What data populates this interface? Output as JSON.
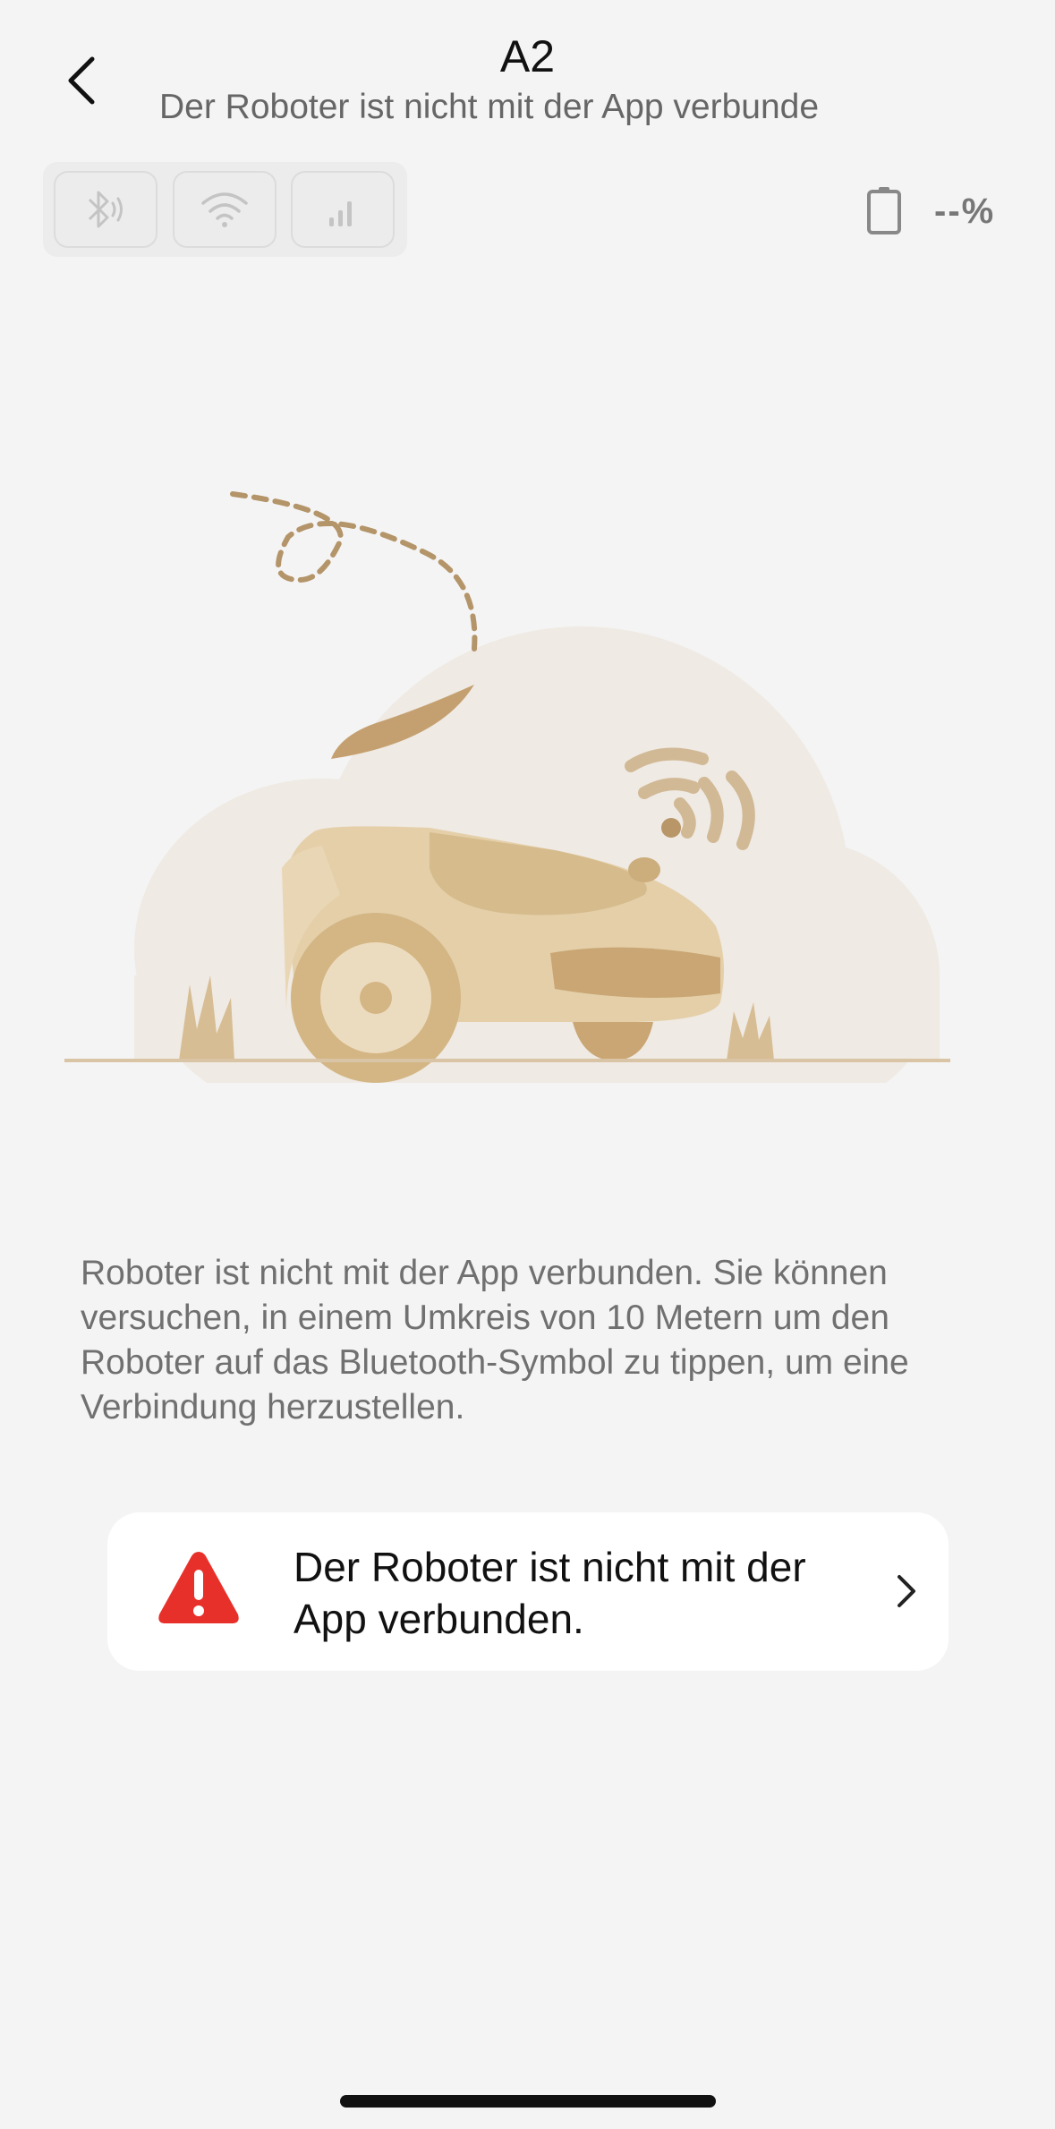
{
  "header": {
    "title": "A2",
    "subtitle": "Der Roboter ist nicht mit der App verbunde"
  },
  "status": {
    "battery_text": "--%",
    "icons": [
      "bluetooth-icon",
      "wifi-icon",
      "cellular-signal-icon"
    ]
  },
  "main": {
    "description": "Roboter ist nicht mit der App verbunden. Sie können versuchen, in einem Umkreis von 10 Metern um den Roboter auf das Bluetooth-Symbol zu tippen, um eine Verbindung herzustellen."
  },
  "alert": {
    "text": "Der Roboter ist nicht mit der App verbunden.",
    "icon": "warning-icon",
    "color": "#e8302a"
  },
  "colors": {
    "background": "#f4f4f4",
    "illustration_accent": "#c7a77a"
  }
}
